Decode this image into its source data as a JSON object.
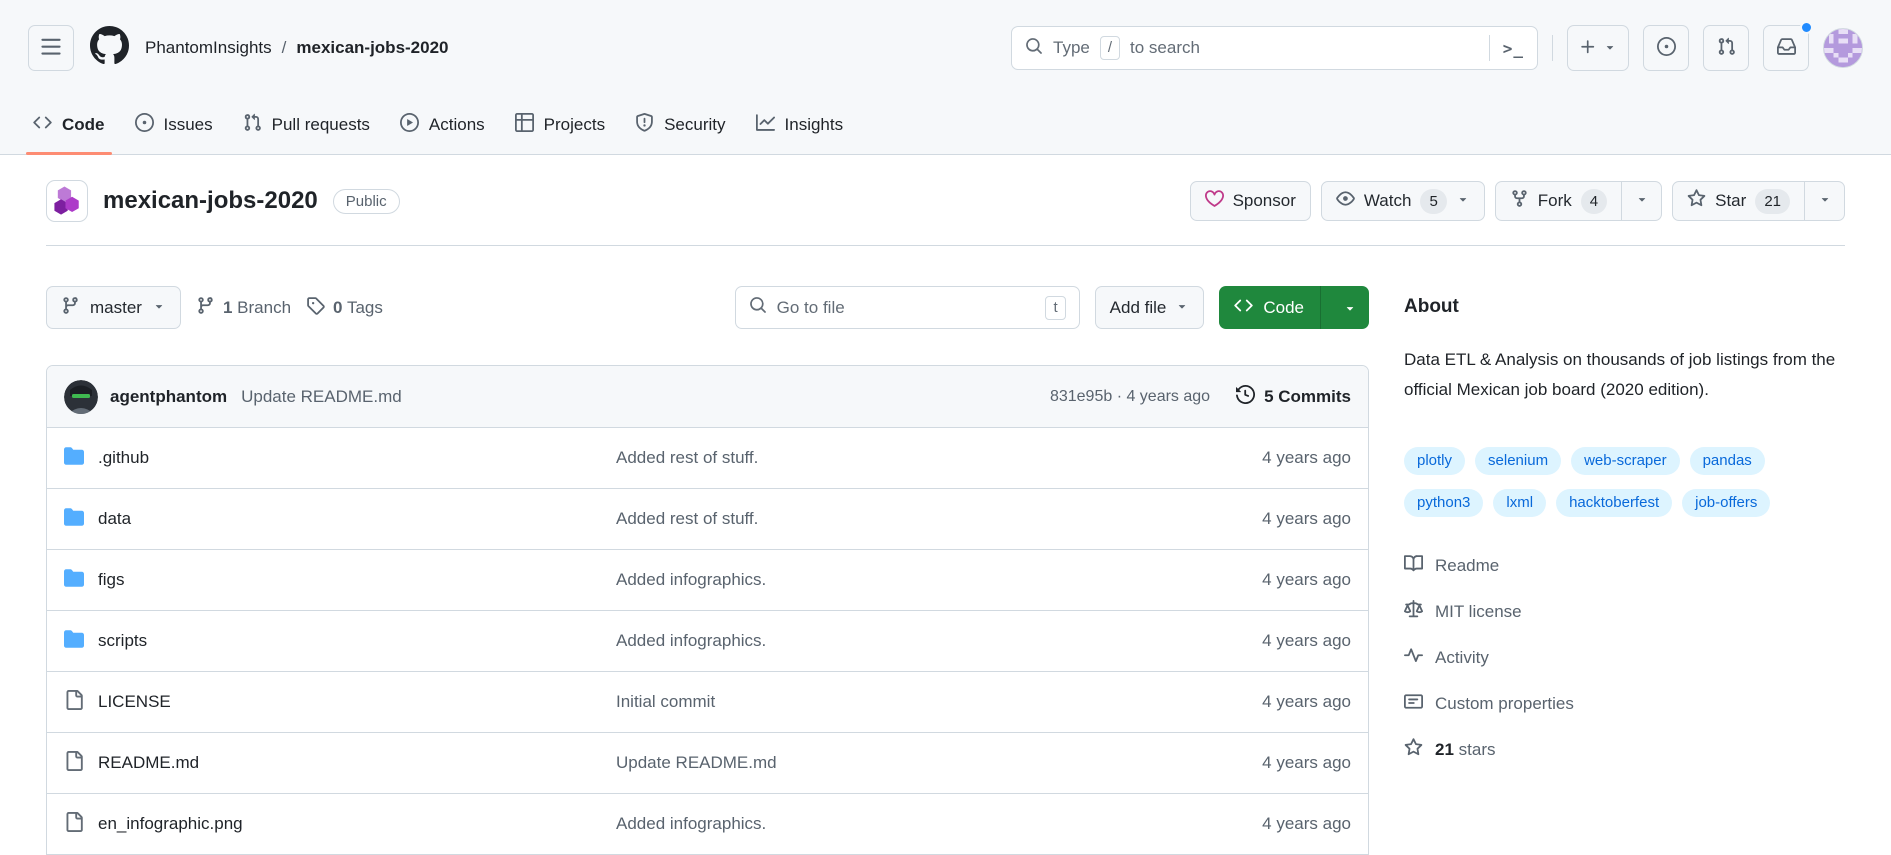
{
  "header": {
    "breadcrumb": {
      "owner": "PhantomInsights",
      "separator": "/",
      "repo": "mexican-jobs-2020"
    },
    "search": {
      "prefix": "Type",
      "key": "/",
      "suffix": "to search",
      "terminal_hint": ">_"
    }
  },
  "nav_tabs": [
    {
      "label": "Code"
    },
    {
      "label": "Issues"
    },
    {
      "label": "Pull requests"
    },
    {
      "label": "Actions"
    },
    {
      "label": "Projects"
    },
    {
      "label": "Security"
    },
    {
      "label": "Insights"
    }
  ],
  "repo": {
    "title": "mexican-jobs-2020",
    "visibility": "Public",
    "sponsor_label": "Sponsor",
    "watch_label": "Watch",
    "watch_count": "5",
    "fork_label": "Fork",
    "fork_count": "4",
    "star_label": "Star",
    "star_count": "21"
  },
  "toolbar": {
    "branch": "master",
    "branch_count": "1",
    "branch_word": "Branch",
    "tag_count": "0",
    "tag_word": "Tags",
    "goto_placeholder": "Go to file",
    "goto_key": "t",
    "add_file_label": "Add file",
    "code_label": "Code"
  },
  "commit_bar": {
    "author": "agentphantom",
    "message": "Update README.md",
    "sha_time": "831e95b · 4 years ago",
    "commits": "5 Commits"
  },
  "files": {
    "rows": [
      {
        "name": ".github",
        "type": "folder",
        "message": "Added rest of stuff.",
        "time": "4 years ago"
      },
      {
        "name": "data",
        "type": "folder",
        "message": "Added rest of stuff.",
        "time": "4 years ago"
      },
      {
        "name": "figs",
        "type": "folder",
        "message": "Added infographics.",
        "time": "4 years ago"
      },
      {
        "name": "scripts",
        "type": "folder",
        "message": "Added infographics.",
        "time": "4 years ago"
      },
      {
        "name": "LICENSE",
        "type": "file",
        "message": "Initial commit",
        "time": "4 years ago"
      },
      {
        "name": "README.md",
        "type": "file",
        "message": "Update README.md",
        "time": "4 years ago"
      },
      {
        "name": "en_infographic.png",
        "type": "file",
        "message": "Added infographics.",
        "time": "4 years ago"
      }
    ]
  },
  "sidebar": {
    "about_title": "About",
    "description": "Data ETL & Analysis on thousands of job listings from the official Mexican job board (2020 edition).",
    "topics": [
      "plotly",
      "selenium",
      "web-scraper",
      "pandas",
      "python3",
      "lxml",
      "hacktoberfest",
      "job-offers"
    ],
    "links": [
      {
        "label": "Readme"
      },
      {
        "label": "MIT license"
      },
      {
        "label": "Activity"
      },
      {
        "label": "Custom properties"
      }
    ],
    "stars_count": "21",
    "stars_label": "stars"
  },
  "colors": {
    "accent_green": "#1f883d",
    "tab_underline": "#fd8c73",
    "topic_bg": "#ddf4ff",
    "topic_text": "#0969da",
    "folder_icon": "#54aeff",
    "notification_dot": "#218bff",
    "sponsor_heart": "#bf3989",
    "header_bg": "#f6f8fa",
    "border": "#d1d9e0"
  }
}
